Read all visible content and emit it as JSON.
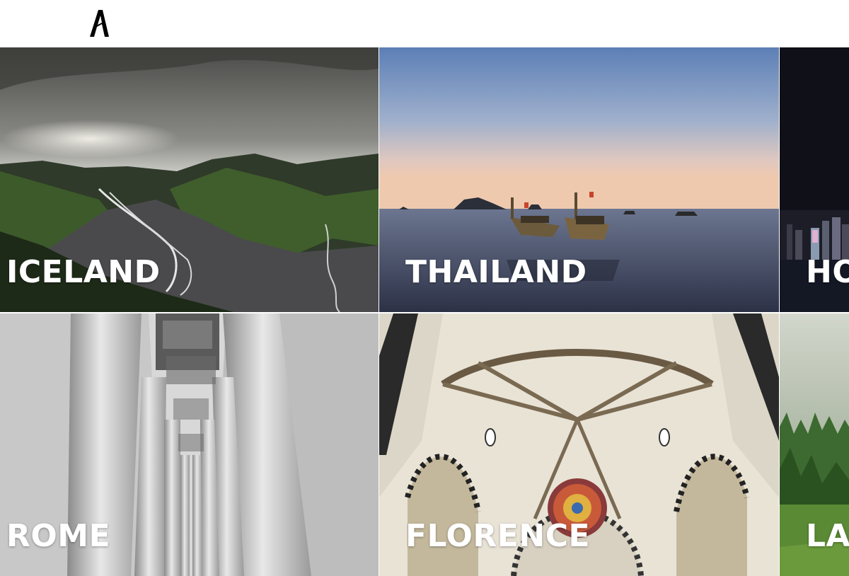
{
  "header": {
    "logo_name": "brand-logo-icon"
  },
  "destinations": [
    {
      "id": "iceland",
      "label": "ICELAND"
    },
    {
      "id": "thailand",
      "label": "THAILAND"
    },
    {
      "id": "hongkong",
      "label": "HO"
    },
    {
      "id": "rome",
      "label": "ROME"
    },
    {
      "id": "florence",
      "label": "FLORENCE"
    },
    {
      "id": "la",
      "label": "LA"
    }
  ],
  "colors": {
    "label": "#ffffff",
    "background": "#ffffff",
    "logo": "#000000"
  }
}
